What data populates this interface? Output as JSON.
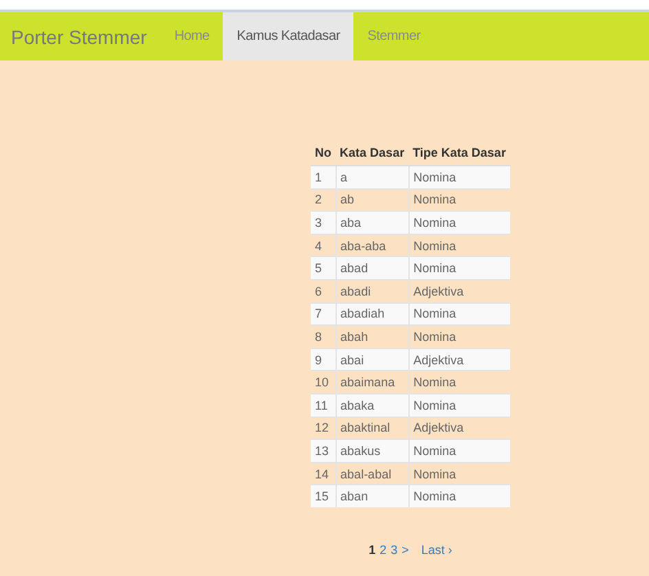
{
  "navbar": {
    "brand": "Porter Stemmer",
    "items": [
      {
        "label": "Home",
        "selected": false
      },
      {
        "label": "Kamus Katadasar",
        "selected": true
      },
      {
        "label": "Stemmer",
        "selected": false
      }
    ]
  },
  "table": {
    "columns": [
      "No",
      "Kata Dasar",
      "Tipe Kata Dasar"
    ],
    "rows": [
      [
        "1",
        "a",
        "Nomina"
      ],
      [
        "2",
        "ab",
        "Nomina"
      ],
      [
        "3",
        "aba",
        "Nomina"
      ],
      [
        "4",
        "aba-aba",
        "Nomina"
      ],
      [
        "5",
        "abad",
        "Nomina"
      ],
      [
        "6",
        "abadi",
        "Adjektiva"
      ],
      [
        "7",
        "abadiah",
        "Nomina"
      ],
      [
        "8",
        "abah",
        "Nomina"
      ],
      [
        "9",
        "abai",
        "Adjektiva"
      ],
      [
        "10",
        "abaimana",
        "Nomina"
      ],
      [
        "11",
        "abaka",
        "Nomina"
      ],
      [
        "12",
        "abaktinal",
        "Adjektiva"
      ],
      [
        "13",
        "abakus",
        "Nomina"
      ],
      [
        "14",
        "abal-abal",
        "Nomina"
      ],
      [
        "15",
        "aban",
        "Nomina"
      ]
    ]
  },
  "pagination": [
    {
      "label": "1",
      "selected": true
    },
    {
      "label": "2",
      "selected": false
    },
    {
      "label": "3",
      "selected": false
    },
    {
      "label": ">",
      "selected": false
    },
    {
      "label": "Last ›",
      "selected": false
    }
  ]
}
